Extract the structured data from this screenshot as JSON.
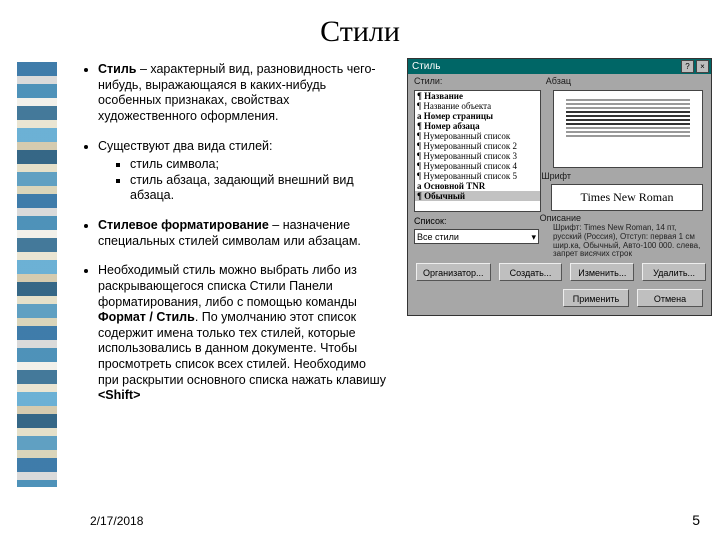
{
  "title": "Стили",
  "bullets": {
    "b1_strong": "Стиль",
    "b1_rest": " – характерный вид, разновидность чего-нибудь, выражающаяся в каких-нибудь особенных признаках, свойствах художественного оформления.",
    "b2": "Существуют два вида стилей:",
    "b2_sub1": "стиль символа;",
    "b2_sub2": "стиль абзаца, задающий внешний вид абзаца.",
    "b3_strong": "Стилевое форматирование",
    "b3_rest": " – назначение специальных стилей символам или абзацам.",
    "b4_part1": "Необходимый стиль можно выбрать либо из раскрывающегося списка Стили Панели форматирования, либо с помощью команды ",
    "b4_strong1": "Формат / Стиль",
    "b4_part2": ". По умолчанию этот список содержит имена только тех стилей, которые использовались в данном документе. Чтобы просмотреть список всех стилей. Необходимо при раскрытии основного списка нажать клавишу ",
    "b4_strong2": "<Shift>"
  },
  "dialog": {
    "title": "Стиль",
    "help": "?",
    "close": "×",
    "labels": {
      "styles": "Стили:",
      "para": "Абзац",
      "font": "Шрифт",
      "desc": "Описание",
      "list": "Список:"
    },
    "style_items": [
      "¶ Название",
      "¶ Название объекта",
      "a Номер страницы",
      "¶ Номер абзаца",
      "¶ Нумерованный список",
      "¶ Нумерованный список 2",
      "¶ Нумерованный список 3",
      "¶ Нумерованный список 4",
      "¶ Нумерованный список 5",
      "a Основной TNR",
      "¶ Обычный"
    ],
    "preview_font": "Times New Roman",
    "desc_text": "Шрифт: Times New Roman, 14 пт, русский (Россия), Отступ: первая 1 см шир.ка, Обычный, Авто-100 000. слева, запрет висячих строк",
    "dropdown": "Все стили",
    "buttons": {
      "org": "Организатор...",
      "new": "Создать...",
      "edit": "Изменить...",
      "del": "Удалить...",
      "apply": "Применить",
      "cancel": "Отмена"
    }
  },
  "footer": {
    "date": "2/17/2018",
    "page": "5"
  }
}
